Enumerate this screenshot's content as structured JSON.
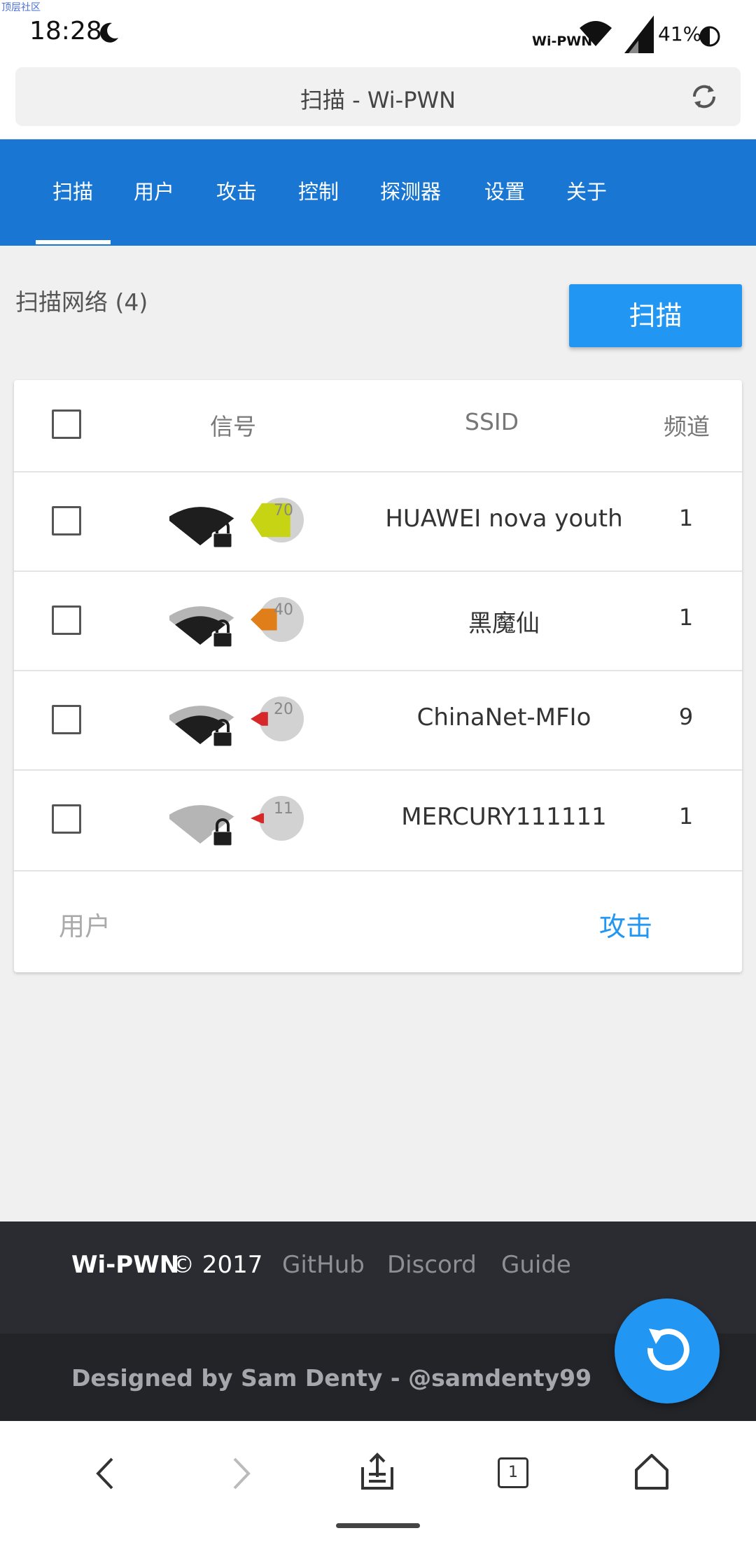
{
  "status": {
    "corner_tag": "顶层社区",
    "time": "18:28",
    "wifi_label": "Wi-PWN",
    "battery": "41%"
  },
  "browser": {
    "title": "扫描 - Wi-PWN",
    "tab_count": "1"
  },
  "nav": {
    "tabs": [
      "扫描",
      "用户",
      "攻击",
      "控制",
      "探测器",
      "设置",
      "关于"
    ],
    "active_index": 0
  },
  "scan": {
    "title": "扫描网络 (4)",
    "button_label": "扫描"
  },
  "table": {
    "headers": {
      "signal": "信号",
      "ssid": "SSID",
      "channel": "频道"
    },
    "rows": [
      {
        "signal_percent": 70,
        "signal_bars": 3,
        "gauge_color": "#c6d414",
        "ssid": "HUAWEI nova youth",
        "channel": "1"
      },
      {
        "signal_percent": 40,
        "signal_bars": 2,
        "gauge_color": "#e07f1a",
        "ssid": "黑魔仙",
        "channel": "1"
      },
      {
        "signal_percent": 20,
        "signal_bars": 2,
        "gauge_color": "#d62828",
        "ssid": "ChinaNet-MFIo",
        "channel": "9"
      },
      {
        "signal_percent": 11,
        "signal_bars": 0,
        "gauge_color": "#d62828",
        "ssid": "MERCURY111111",
        "channel": "1"
      }
    ]
  },
  "card_footer": {
    "users_label": "用户",
    "attack_label": "攻击"
  },
  "footer": {
    "brand": "Wi-PWN",
    "copyright": "© 2017",
    "links": [
      "GitHub",
      "Discord",
      "Guide"
    ],
    "designer": "Designed by Sam Denty - @samdenty99"
  },
  "colors": {
    "primary": "#1976d2",
    "accent": "#2196f3",
    "footer_dark": "#2b2c31"
  }
}
